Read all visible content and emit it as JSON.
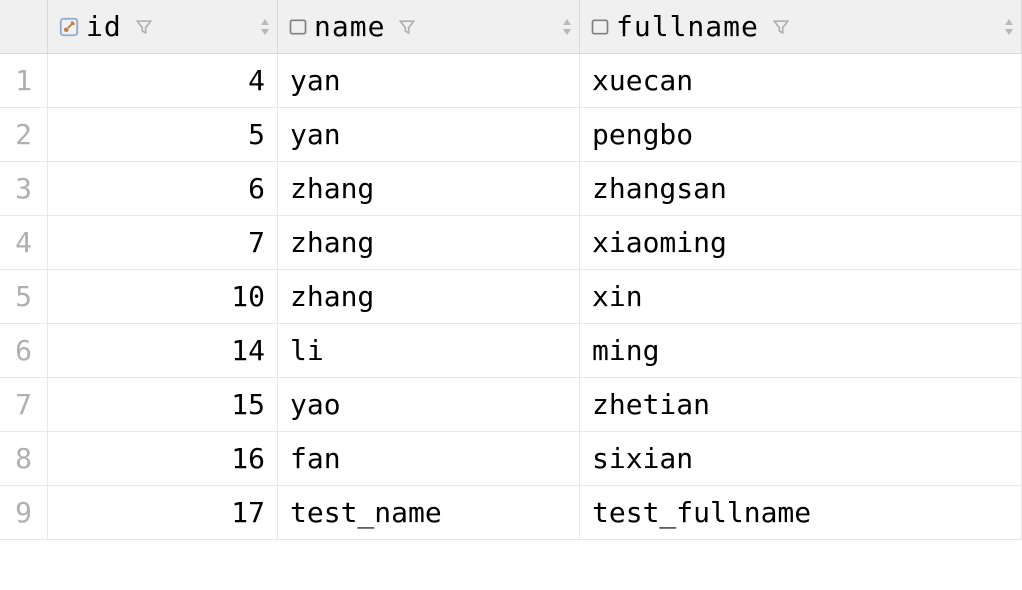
{
  "columns": [
    {
      "key": "id",
      "label": "id",
      "type": "pk"
    },
    {
      "key": "name",
      "label": "name",
      "type": "text"
    },
    {
      "key": "fullname",
      "label": "fullname",
      "type": "text"
    }
  ],
  "rows": [
    {
      "n": "1",
      "id": "4",
      "name": "yan",
      "fullname": "xuecan"
    },
    {
      "n": "2",
      "id": "5",
      "name": "yan",
      "fullname": "pengbo"
    },
    {
      "n": "3",
      "id": "6",
      "name": "zhang",
      "fullname": "zhangsan"
    },
    {
      "n": "4",
      "id": "7",
      "name": "zhang",
      "fullname": "xiaoming"
    },
    {
      "n": "5",
      "id": "10",
      "name": "zhang",
      "fullname": "xin"
    },
    {
      "n": "6",
      "id": "14",
      "name": "li",
      "fullname": "ming"
    },
    {
      "n": "7",
      "id": "15",
      "name": "yao",
      "fullname": "zhetian"
    },
    {
      "n": "8",
      "id": "16",
      "name": "fan",
      "fullname": "sixian"
    },
    {
      "n": "9",
      "id": "17",
      "name": "test_name",
      "fullname": "test_fullname"
    }
  ]
}
